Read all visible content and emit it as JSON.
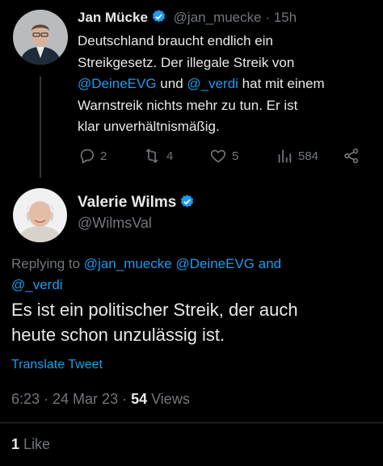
{
  "tweet1": {
    "author_name": "Jan Mücke",
    "handle_time": "@jan_muecke · 15h",
    "text_lines": [
      [
        {
          "t": "Deutschland braucht endlich ein",
          "link": false
        }
      ],
      [
        {
          "t": "Streikgesetz. Der illegale Streik von",
          "link": false
        }
      ],
      [
        {
          "t": "@DeineEVG",
          "link": true
        },
        {
          "t": " und ",
          "link": false
        },
        {
          "t": "@_verdi",
          "link": true
        },
        {
          "t": " hat mit einem",
          "link": false
        }
      ],
      [
        {
          "t": "Warnstreik nichts mehr zu tun. Er ist",
          "link": false
        }
      ],
      [
        {
          "t": "klar unverhältnismäßig.",
          "link": false
        }
      ]
    ],
    "replies": "2",
    "retweets": "4",
    "likes": "5",
    "views": "584"
  },
  "tweet2": {
    "author_name": "Valerie Wilms",
    "handle": "@WilmsVal",
    "replying_prefix": "Replying to",
    "replying_users_line1": "@jan_muecke @DeineEVG and",
    "replying_users_line2": "@_verdi",
    "text_line1": "Es ist ein politischer Streik, der auch",
    "text_line2": "heute schon unzulässig ist.",
    "translate": "Translate Tweet",
    "timestamp": "6:23 · 24 Mar 23 · ",
    "views_count": "54",
    "views_label": "Views",
    "likes_count": "1",
    "likes_label": "Like"
  },
  "colors": {
    "background": "#000000",
    "text": "#e7e9ea",
    "muted": "#71767b",
    "link": "#1d9bf0",
    "verified": "#1d9bf0"
  },
  "icons": [
    "verified-badge-icon",
    "reply-icon",
    "retweet-icon",
    "like-icon",
    "views-icon",
    "share-icon"
  ]
}
